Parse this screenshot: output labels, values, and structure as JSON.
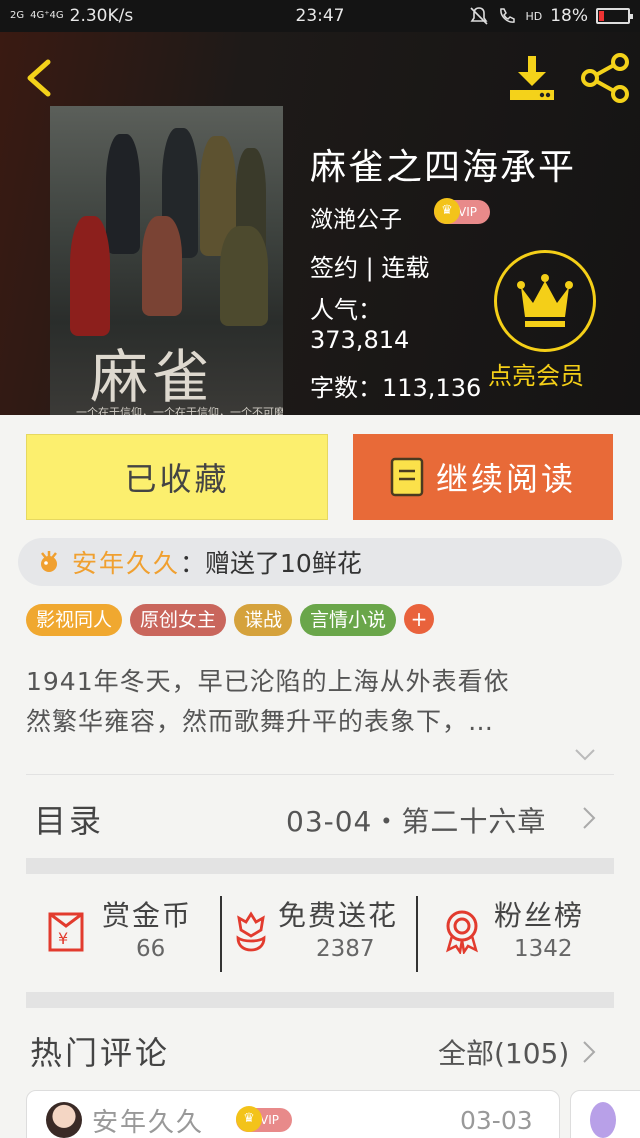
{
  "status_bar": {
    "signal_1": "2G",
    "signal_2": "4G⁺4G",
    "net_speed": "2.30K/s",
    "time": "23:47",
    "network": "HD",
    "battery": "18%",
    "battery_level": 0.18
  },
  "book": {
    "title": "麻雀之四海承平",
    "author": "潋滟公子",
    "vip_badge": "VIP",
    "status": "签约 | 连载",
    "popularity_label": "人气：",
    "popularity_value": "373,814",
    "word_count": "字数：113,136",
    "cover_title": "麻雀",
    "cover_sub": "一个在于信仰，一个在于信仰，一个不可磨灭"
  },
  "member": {
    "label": "点亮会员"
  },
  "actions": {
    "favorited": "已收藏",
    "continue_reading": "继续阅读"
  },
  "gift_notice": {
    "user": "安年久久",
    "message": "：赠送了10鲜花"
  },
  "tags": [
    {
      "label": "影视同人",
      "color": "#f0a830"
    },
    {
      "label": "原创女主",
      "color": "#c9665c"
    },
    {
      "label": "谍战",
      "color": "#d5a23c"
    },
    {
      "label": "言情小说",
      "color": "#6aa64a"
    }
  ],
  "tag_add": "+",
  "description": {
    "line1": "1941年冬天，早已沦陷的上海从外表看依",
    "line2": "然繁华雍容，然而歌舞升平的表象下，…"
  },
  "toc": {
    "label": "目录",
    "latest": "03-04・第二十六章"
  },
  "stats": [
    {
      "label": "赏金币",
      "value": "66"
    },
    {
      "label": "免费送花",
      "value": "2387"
    },
    {
      "label": "粉丝榜",
      "value": "1342"
    }
  ],
  "comments": {
    "section_label": "热门评论",
    "all_label": "全部(105)",
    "first": {
      "user": "安年久久",
      "vip": "VIP",
      "date": "03-03"
    }
  },
  "colors": {
    "accent_yellow": "#fcef6e",
    "accent_orange": "#e86a38",
    "gold": "#f4cf18"
  }
}
